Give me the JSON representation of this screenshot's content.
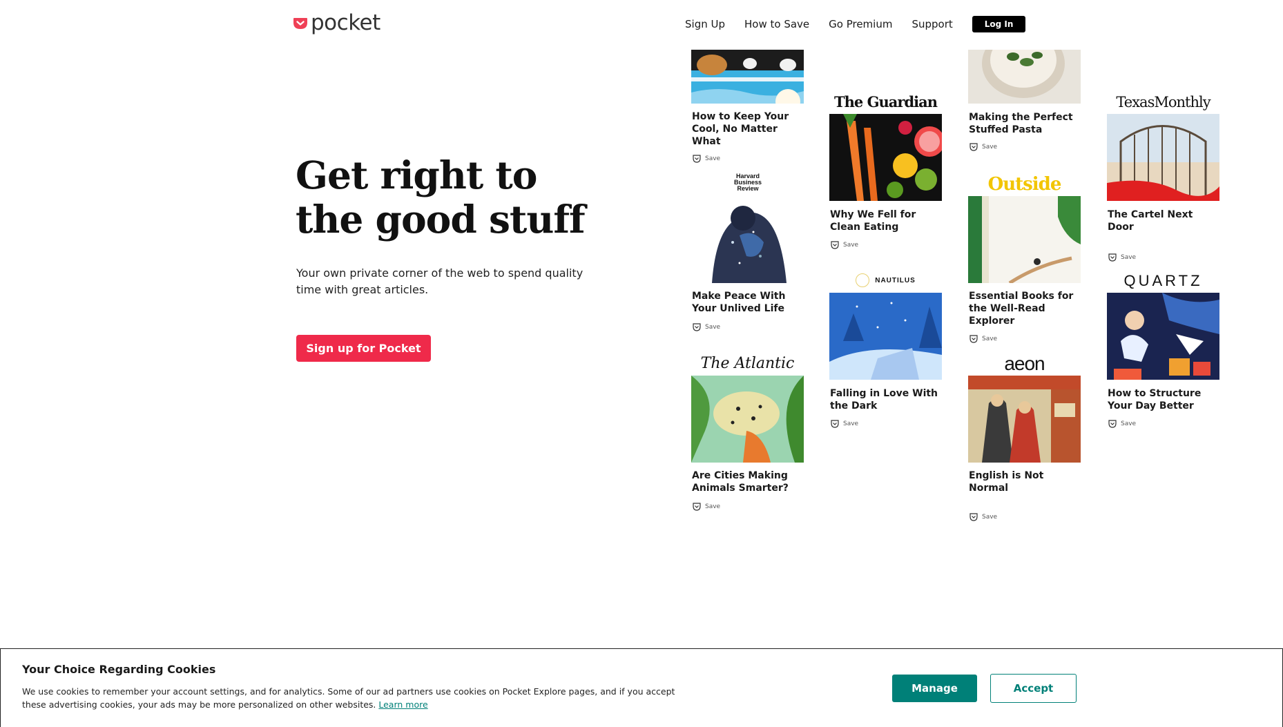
{
  "header": {
    "logo_text": "pocket",
    "nav": [
      "Sign Up",
      "How to Save",
      "Go Premium",
      "Support"
    ],
    "login_label": "Log In"
  },
  "hero": {
    "title_line1": "Get right to",
    "title_line2": "the good stuff",
    "subtitle": "Your own private corner of the web to spend quality time with great articles.",
    "cta_label": "Sign up for Pocket"
  },
  "save_label": "Save",
  "cards": [
    {
      "publisher": "",
      "title": "How to Keep Your Cool, No Matter What"
    },
    {
      "publisher": "Harvard Business Review",
      "title": "Make Peace With Your Unlived Life"
    },
    {
      "publisher": "The Atlantic",
      "title": "Are Cities Making Animals Smarter?"
    },
    {
      "publisher": "The Guardian",
      "title": "Why We Fell for Clean Eating"
    },
    {
      "publisher": "NAUTILUS",
      "title": "Falling in Love With the Dark"
    },
    {
      "publisher": "",
      "title": "Making the Perfect Stuffed Pasta"
    },
    {
      "publisher": "Outside",
      "title": "Essential Books for the Well-Read Explorer"
    },
    {
      "publisher": "aeon",
      "title": "English is Not Normal"
    },
    {
      "publisher": "TexasMonthly",
      "title": "The Cartel Next Door"
    },
    {
      "publisher": "QUARTZ",
      "title": "How to Structure Your Day Better"
    }
  ],
  "cookie": {
    "title": "Your Choice Regarding Cookies",
    "text": "We use cookies to remember your account settings, and for analytics. Some of our ad partners use cookies on Pocket Explore pages, and if you accept these advertising cookies, your ads may be more personalized on other websites.",
    "link": "Learn more",
    "manage": "Manage",
    "accept": "Accept"
  },
  "colors": {
    "brand_red": "#ef2a4a",
    "teal": "#008078",
    "black": "#000000"
  }
}
